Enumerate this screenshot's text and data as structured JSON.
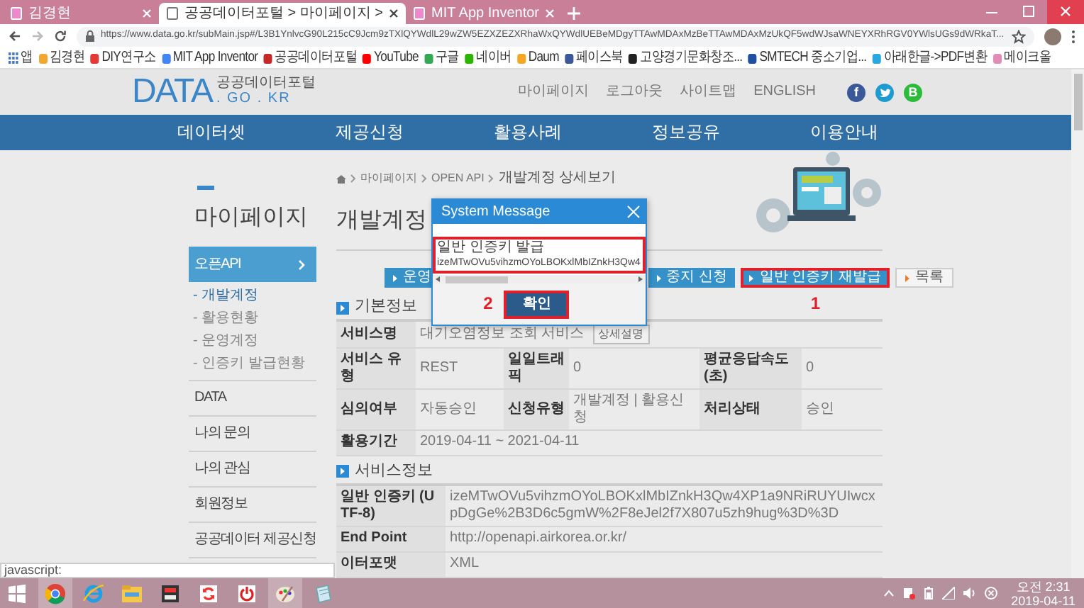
{
  "browser": {
    "tabs": [
      {
        "title": "김경현",
        "selected": false
      },
      {
        "title": "공공데이터포털 > 마이페이지 >",
        "selected": true
      },
      {
        "title": "MIT App Inventor",
        "selected": false
      }
    ],
    "url": "https://www.data.go.kr/subMain.jsp#/L3B1YnlvcG90L215cC9Jcm9zTXlQYWdlL29wZW5EZXZEZXRhaWxQYWdlUEBeMDgyTTAwMDAxMzBeTTAwMDAxMzUkQF5wdWJsaWNEYXRhRGV0YWlsUGs9dWRkaT...",
    "bookmarks": [
      {
        "label": "앱",
        "kind": "apps",
        "color": "#4a78c2"
      },
      {
        "label": "김경현",
        "kind": "site",
        "color": "#f0a830"
      },
      {
        "label": "DIY연구소",
        "kind": "site",
        "color": "#e53935"
      },
      {
        "label": "MIT App Inventor",
        "kind": "site",
        "color": "#4285f4"
      },
      {
        "label": "공공데이터포털",
        "kind": "site",
        "color": "#c62828"
      },
      {
        "label": "YouTube",
        "kind": "site",
        "color": "#ff0000"
      },
      {
        "label": "구글",
        "kind": "site",
        "color": "#34a853"
      },
      {
        "label": "네이버",
        "kind": "site",
        "color": "#2db400"
      },
      {
        "label": "Daum",
        "kind": "site",
        "color": "#f5a623"
      },
      {
        "label": "페이스북",
        "kind": "site",
        "color": "#3b5998"
      },
      {
        "label": "고양경기문화창조...",
        "kind": "site",
        "color": "#222222"
      },
      {
        "label": "SMTECH 중소기업...",
        "kind": "site",
        "color": "#1e4fa0"
      },
      {
        "label": "아래한글->PDF변환",
        "kind": "site",
        "color": "#29a8e0"
      },
      {
        "label": "메이크올",
        "kind": "site",
        "color": "#e08cb4"
      }
    ]
  },
  "site": {
    "logo": {
      "main": "DATA",
      "sub": "공공데이터포털",
      "domain": ". GO . KR"
    },
    "top_links": [
      "마이페이지",
      "로그아웃",
      "사이트맵",
      "ENGLISH"
    ],
    "social": [
      {
        "kind": "facebook",
        "glyph": "f",
        "color": "#3b5998"
      },
      {
        "kind": "twitter",
        "color": "#1d9bd1"
      },
      {
        "kind": "blog",
        "glyph": "B",
        "color": "#2dbb3c"
      }
    ],
    "nav": [
      "데이터셋",
      "제공신청",
      "활용사례",
      "정보공유",
      "이용안내"
    ]
  },
  "sidebar": {
    "title": "마이페이지",
    "items": [
      {
        "label": "오픈API",
        "selected": true,
        "children": [
          {
            "label": "- 개발계정",
            "selected": true
          },
          {
            "label": "- 활용현황",
            "selected": false
          },
          {
            "label": "- 운영계정",
            "selected": false
          },
          {
            "label": "- 인증키 발급현황",
            "selected": false
          }
        ]
      },
      {
        "label": "DATA",
        "selected": false
      },
      {
        "label": "나의 문의",
        "selected": false
      },
      {
        "label": "나의 관심",
        "selected": false
      },
      {
        "label": "회원정보",
        "selected": false
      },
      {
        "label": "공공데이터 제공신청",
        "selected": false
      }
    ]
  },
  "breadcrumb": [
    "마이페이지",
    "OPEN API",
    "개발계정 상세보기"
  ],
  "page_title": "개발계정",
  "actions": [
    {
      "label": "운영",
      "kind": "primary",
      "highlighted": false
    },
    {
      "label": "중지 신청",
      "kind": "primary",
      "highlighted": false
    },
    {
      "label": "일반 인증키 재발급",
      "kind": "primary",
      "highlighted": true,
      "step": "1"
    },
    {
      "label": "목록",
      "kind": "secondary",
      "highlighted": false
    }
  ],
  "sections": [
    {
      "title": "기본정보",
      "rows": [
        [
          {
            "kind": "head",
            "text": "서비스명"
          },
          {
            "kind": "value",
            "text": "대기오염정보 조회 서비스",
            "button": "상세설명"
          }
        ],
        [
          {
            "kind": "head",
            "text": "서비스 유형"
          },
          {
            "kind": "value",
            "text": "REST"
          },
          {
            "kind": "head",
            "text": "일일트래픽"
          },
          {
            "kind": "value",
            "text": "0"
          },
          {
            "kind": "head",
            "text": "평균응답속도(초)"
          },
          {
            "kind": "value",
            "text": "0"
          }
        ],
        [
          {
            "kind": "head",
            "text": "심의여부"
          },
          {
            "kind": "value",
            "text": "자동승인"
          },
          {
            "kind": "head",
            "text": "신청유형"
          },
          {
            "kind": "value",
            "text": "개발계정 | 활용신청"
          },
          {
            "kind": "head",
            "text": "처리상태"
          },
          {
            "kind": "value",
            "text": "승인"
          }
        ],
        [
          {
            "kind": "head",
            "text": "활용기간"
          },
          {
            "kind": "value",
            "text": "2019-04-11 ~ 2021-04-11"
          }
        ]
      ]
    },
    {
      "title": "서비스정보",
      "rows": [
        [
          {
            "kind": "head",
            "text": "일반 인증키 (UTF-8)"
          },
          {
            "kind": "value",
            "text": "izeMTwOVu5vihzmOYoLBOKxlMbIZnkH3Qw4XP1a9NRiRUYUIwcxpDgGe%2B3D6c5gmW%2F8eJel2f7X807u5zh9hug%3D%3D"
          }
        ],
        [
          {
            "kind": "head",
            "text": "End Point"
          },
          {
            "kind": "value",
            "text": "http://openapi.airkorea.or.kr/"
          }
        ],
        [
          {
            "kind": "head",
            "text": "이터포맷"
          },
          {
            "kind": "value",
            "text": "XML"
          }
        ]
      ]
    }
  ],
  "dialog": {
    "title": "System Message",
    "message": {
      "heading": "일반 인증키 발급",
      "key": "izeMTwOVu5vihzmOYoLBOKxlMbIZnkH3Qw4",
      "highlighted": true
    },
    "button": {
      "label": "확인",
      "highlighted": true,
      "step": "2"
    }
  },
  "status_text": "javascript:",
  "taskbar": {
    "apps": [
      {
        "kind": "start",
        "selected": false
      },
      {
        "kind": "chrome",
        "selected": true
      },
      {
        "kind": "ie",
        "selected": false
      },
      {
        "kind": "folder",
        "selected": false
      },
      {
        "kind": "switch",
        "selected": false
      },
      {
        "kind": "sync",
        "selected": false
      },
      {
        "kind": "power",
        "selected": false
      },
      {
        "kind": "paint",
        "selected": true
      },
      {
        "kind": "notepad",
        "selected": false
      }
    ],
    "time": "오전 2:31",
    "date": "2019-04-11"
  }
}
